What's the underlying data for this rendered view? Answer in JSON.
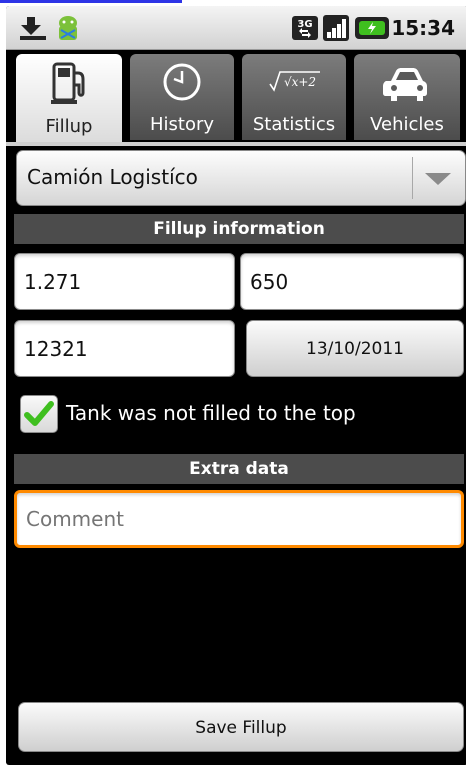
{
  "status_bar": {
    "time": "15:34",
    "network_badge": "3G",
    "icons": [
      "download-complete-icon",
      "android-debug-icon",
      "network-3g-icon",
      "signal-icon",
      "battery-icon"
    ]
  },
  "tabs": [
    {
      "label": "Fillup",
      "icon": "fuel-pump-icon",
      "active": true
    },
    {
      "label": "History",
      "icon": "clock-icon",
      "active": false
    },
    {
      "label": "Statistics",
      "icon": "formula-icon",
      "active": false,
      "icon_text": "√x+2"
    },
    {
      "label": "Vehicles",
      "icon": "car-icon",
      "active": false
    }
  ],
  "vehicle_spinner": {
    "selected": "Camión Logistíco"
  },
  "fillup_info": {
    "header": "Fillup information",
    "field1": "1.271",
    "field2": "650",
    "field3": "12321",
    "date": "13/10/2011"
  },
  "partial_fill": {
    "label": "Tank was not filled to the top",
    "checked": true
  },
  "extra": {
    "header": "Extra data",
    "comment_placeholder": "Comment"
  },
  "save_button": "Save Fillup",
  "colors": {
    "accent_focus": "#ff8a00",
    "check_green": "#3fbf1f",
    "header_bg": "#4c4c4c"
  }
}
